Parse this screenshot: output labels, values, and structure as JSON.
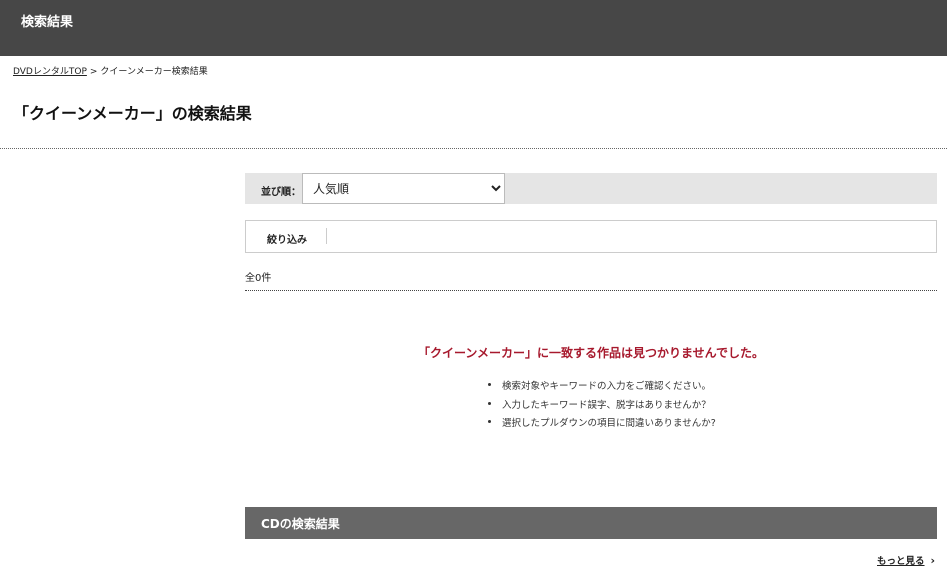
{
  "header": {
    "title": "検索結果"
  },
  "breadcrumb": {
    "home": "DVDレンタルTOP",
    "separator": ">",
    "current": "クイーンメーカー検索結果"
  },
  "page_title": "「クイーンメーカー」の検索結果",
  "sort": {
    "label": "並び順：",
    "selected": "人気順",
    "options": [
      "人気順"
    ]
  },
  "filter": {
    "label": "絞り込み"
  },
  "result_count": "全0件",
  "no_results": {
    "message": "「クイーンメーカー」に一致する作品は見つかりませんでした。",
    "tips": [
      "検索対象やキーワードの入力をご確認ください。",
      "入力したキーワード誤字、脱字はありませんか？",
      "選択したプルダウンの項目に間違いありませんか?"
    ]
  },
  "cd_section": {
    "title": "CDの検索結果",
    "more_label": "もっと見る"
  },
  "colors": {
    "header_bg": "#474747",
    "error_text": "#a7192d",
    "cd_bar_bg": "#676767"
  }
}
